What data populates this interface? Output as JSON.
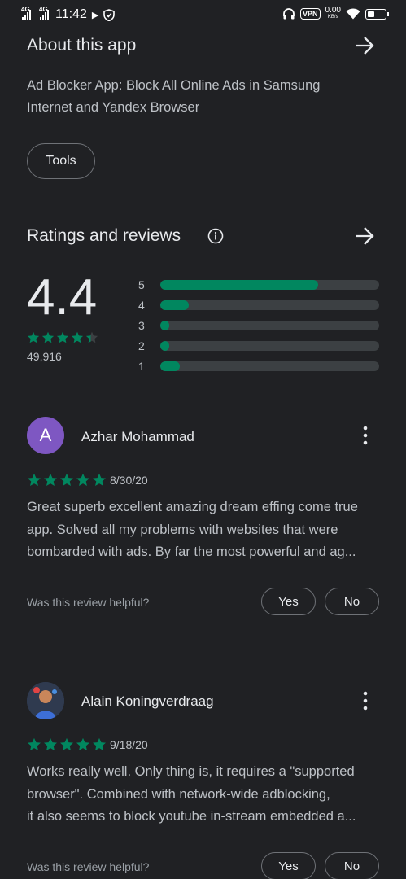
{
  "status_bar": {
    "network_1": "4G",
    "network_2": "4G",
    "time": "11:42",
    "vpn": "VPN",
    "speed_value": "0.00",
    "speed_unit": "KB/s",
    "battery_level": 0.35
  },
  "about": {
    "title": "About this app",
    "description": "Ad Blocker App: Block All Online Ads in Samsung Internet and Yandex Browser",
    "category_chip": "Tools"
  },
  "ratings": {
    "title": "Ratings and reviews",
    "average": "4.4",
    "star_fill": 0.88,
    "total_count": "49,916",
    "histogram": [
      {
        "label": "5",
        "fraction": 0.72
      },
      {
        "label": "4",
        "fraction": 0.13
      },
      {
        "label": "3",
        "fraction": 0.04
      },
      {
        "label": "2",
        "fraction": 0.04
      },
      {
        "label": "1",
        "fraction": 0.09
      }
    ]
  },
  "reviews": [
    {
      "avatar_letter": "A",
      "avatar_color": "#7e57c2",
      "name": "Azhar Mohammad",
      "stars": 5,
      "date": "8/30/20",
      "text_lines": [
        "Great superb excellent amazing dream effing come true",
        "app. Solved all my problems with websites that were",
        "bombarded with ads. By far the most powerful and ag..."
      ],
      "helpful_prompt": "Was this review helpful?",
      "yes_label": "Yes",
      "no_label": "No"
    },
    {
      "avatar_letter": "",
      "avatar_color": "#2f3a4f",
      "name": "Alain Koningverdraag",
      "stars": 5,
      "date": "9/18/20",
      "text_lines": [
        "Works really well. Only thing is, it requires a \"supported",
        "browser\". Combined with network-wide adblocking,",
        "it also seems to block youtube in-stream embedded a..."
      ],
      "helpful_prompt": "Was this review helpful?",
      "yes_label": "Yes",
      "no_label": "No"
    }
  ],
  "colors": {
    "background": "#202124",
    "accent_green": "#01875f",
    "text_primary": "#e8eaed",
    "text_secondary": "#bdc1c6",
    "track": "#3c4043"
  }
}
